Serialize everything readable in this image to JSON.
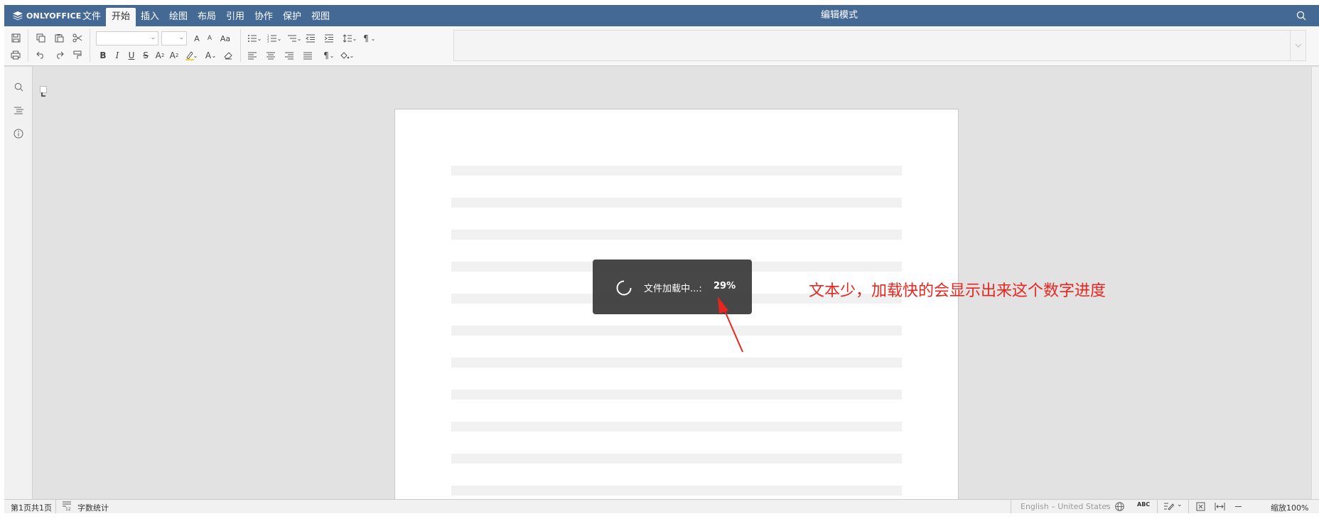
{
  "app": {
    "logo_text": "ONLYOFFICE",
    "mode_title": "编辑模式"
  },
  "menu": {
    "tabs": [
      {
        "label": "文件"
      },
      {
        "label": "开始",
        "active": true
      },
      {
        "label": "插入"
      },
      {
        "label": "绘图"
      },
      {
        "label": "布局"
      },
      {
        "label": "引用"
      },
      {
        "label": "协作"
      },
      {
        "label": "保护"
      },
      {
        "label": "视图"
      }
    ]
  },
  "toolbar": {
    "font_name": "",
    "font_size": "",
    "font_size_increase_icon": "A",
    "font_size_decrease_icon": "A",
    "change_case_icon": "Aa",
    "bold": "B",
    "italic": "I",
    "underline": "U",
    "strike": "S",
    "superscript": "A",
    "subscript": "A",
    "font_color": "A",
    "paragraph_mark": "¶",
    "spell_check": "ABC"
  },
  "loading": {
    "message": "文件加载中...:",
    "percent": "29%"
  },
  "annotation": {
    "text": "文本少，加载快的会显示出来这个数字进度",
    "color": "#e8261f"
  },
  "statusbar": {
    "page_info": "第1页共1页",
    "word_count": "字数统计",
    "language": "English – United States",
    "zoom": "缩放100%"
  },
  "colors": {
    "header": "#446995",
    "toolbar": "#f7f7f7",
    "canvas": "#e2e2e2"
  }
}
